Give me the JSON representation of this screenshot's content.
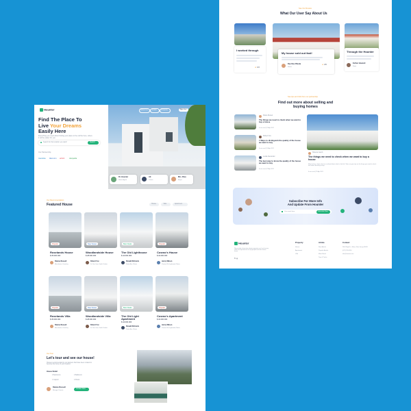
{
  "colors": {
    "background": "#1793d4",
    "accent_green": "#23b37a",
    "accent_orange": "#f2a33a",
    "dark_text": "#1b2338"
  },
  "header": {
    "logo": "Hounter",
    "nav": [
      "About Us",
      "Article",
      "Property"
    ],
    "signup_label": "Sign Up!"
  },
  "hero": {
    "title_l1": "Find The Place To",
    "title_l2a": "Live",
    "title_l2b": "Your Dreams",
    "title_l3": "Easily Here",
    "subtitle": "Everything you need about finding your place to live will be here, where it will be easier for you",
    "search_placeholder": "Search for the location you want!",
    "search_button": "Search",
    "partners_label": "Our Partnership",
    "partners": [
      "traveloka",
      "tiket.com",
      "airbnb",
      "tokopedia"
    ],
    "agent_cards": [
      {
        "name": "Dr. Hounter",
        "sub": "Home Agent"
      },
      {
        "name": "Ali",
        "sub": "Owner"
      },
      {
        "name": "Mrs. Risa",
        "sub": "Buyer"
      }
    ]
  },
  "recommendation": {
    "eyebrow": "Our Recommendation",
    "title": "Featured House",
    "filters": [
      "House",
      "Villa",
      "Apartment"
    ],
    "cards": [
      {
        "badge": "Popular",
        "name": "Roselands House",
        "price": "$ 35.000.000",
        "agent": "Dianne Russell",
        "agent_sub": "Manchester, Kentucky"
      },
      {
        "badge": "New house",
        "name": "Woodlandside House",
        "price": "$ 28.000.000",
        "agent": "Robert Fox",
        "agent_sub": "Dr. San Jose, South Dakota"
      },
      {
        "badge": "Best Deals",
        "name": "The Old Lighthouse",
        "price": "$ 44.000.000",
        "agent": "Ronald Richards",
        "agent_sub": "Santa Ana, Illinois"
      },
      {
        "badge": "Popular",
        "name": "Cosmo's House",
        "price": "$ 32.000.000",
        "agent": "Jenny Wilson",
        "agent_sub": "Preston Rd. Inglewood, Maine"
      },
      {
        "badge": "Popular",
        "name": "Roselands Villa",
        "price": "$ 35.000.000",
        "agent": "Dianne Russell",
        "agent_sub": "Manchester, Kentucky"
      },
      {
        "badge": "New house",
        "name": "Woodlandside Villa",
        "price": "$ 28.000.000",
        "agent": "Robert Fox",
        "agent_sub": "Dr. San Jose, South Dakota"
      },
      {
        "badge": "Best Deals",
        "name": "The Old Light Apartment",
        "price": "$ 44.000.000",
        "agent": "Ronald Richards",
        "agent_sub": "Santa Ana, Illinois"
      },
      {
        "badge": "Popular",
        "name": "Cosmo's Apartment",
        "price": "$ 32.000.000",
        "agent": "Jenny Wilson",
        "agent_sub": "Preston Rd. Inglewood, Maine"
      }
    ]
  },
  "tour": {
    "eyebrow": "Our Tour",
    "title": "Let's tour and see our house!",
    "desc": "Houses recommended by our partners that have been curated to become the home of your dreams!",
    "detail_label": "House Detail",
    "features": [
      "4 Bedrooms",
      "4 Bathroom",
      "1 Carport",
      "2 Floors"
    ],
    "agent": "Dianne Russell",
    "agent_sub": "Manager Director",
    "cta": "Contact Now"
  },
  "testimonials": {
    "eyebrow": "See Our Review",
    "title": "What Our User Say About Us",
    "cards": [
      {
        "quote": "I worked through",
        "name": "",
        "rating": "4.3"
      },
      {
        "quote": "My house sold out fast!",
        "name": "Dee Dee Rhoda",
        "sub": "Renter",
        "rating": "4.5"
      },
      {
        "quote": "Through the Hounter",
        "name": "Esther Howard",
        "sub": "Buyer",
        "rating": ""
      }
    ]
  },
  "articles": {
    "eyebrow": "See tips and trick from our partnership",
    "title_l1": "Find out more about selling and",
    "title_l2": "buying homes",
    "list": [
      {
        "author": "Diana Russel",
        "title": "The things we need to check when we want to buy a house",
        "meta": "4 min read | 25 Apr 2021"
      },
      {
        "author": "Robert Fox",
        "title": "7 Ways to distinguish the quality of the house we want to buy",
        "meta": "4 min read | 24 Apr 2021"
      },
      {
        "author": "Leslie Alexander",
        "title": "The best way to know the quality of the house we want to buy",
        "meta": "6 min read | 22 Apr 2021"
      }
    ],
    "feature": {
      "author": "Shauna Jacob",
      "title": "The things we need to check when we want to buy a house",
      "desc": "Want to buy a house but are confused about what to look for? Here we give tips on the things you need to check first before deciding to buy.",
      "meta": "4 min read | 25 Apr 2021"
    }
  },
  "subscribe": {
    "title_l1": "Subscribe For More Info",
    "title_l2": "And Update From Hounter",
    "placeholder": "Your email here",
    "button": "Subscribe Now"
  },
  "footer": {
    "logo": "Hounter",
    "desc": "We provide information about properties such as houses, villas and apartments to help people find their dream home",
    "cols": [
      {
        "title": "Property",
        "links": [
          "House",
          "Apartment",
          "Villa"
        ]
      },
      {
        "title": "Article",
        "links": [
          "New Article",
          "Popular Article",
          "Most Read",
          "Tips & Tricks"
        ]
      },
      {
        "title": "Contact",
        "links": [
          "2464 Royal Ln. Mesa, New Jersey 45463",
          "(671) 555-0110",
          "info@hounter.com"
        ]
      }
    ]
  }
}
